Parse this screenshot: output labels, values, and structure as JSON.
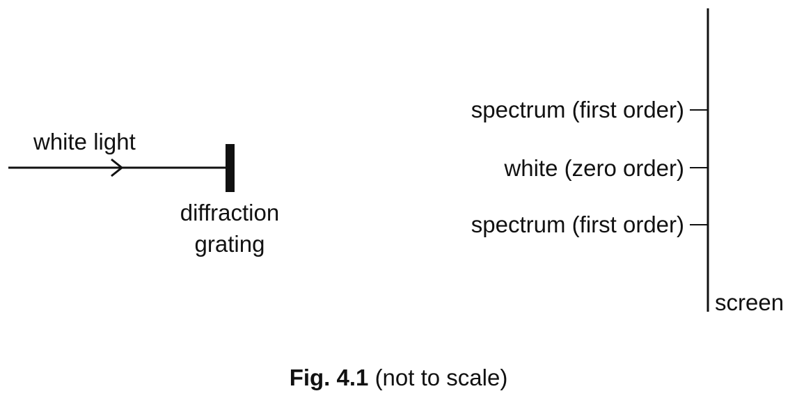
{
  "labels": {
    "incident": "white light",
    "grating_line1": "diffraction",
    "grating_line2": "grating",
    "spectrum_upper": "spectrum (first order)",
    "zero_order": "white (zero order)",
    "spectrum_lower": "spectrum (first order)",
    "screen": "screen"
  },
  "caption": {
    "figure": "Fig. 4.1",
    "note": "(not to scale)"
  },
  "colors": {
    "line": "#111111",
    "background": "#ffffff"
  }
}
